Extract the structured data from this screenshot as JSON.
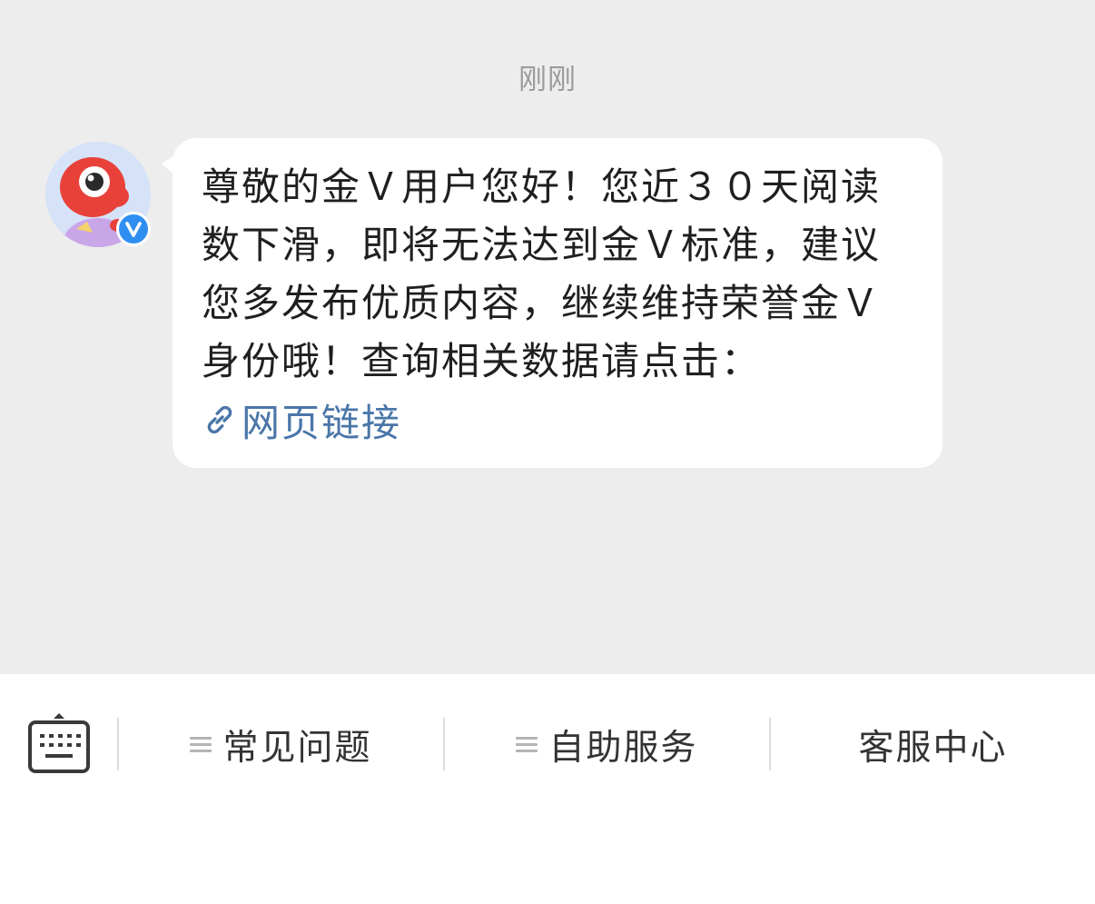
{
  "chat": {
    "timestamp": "刚刚",
    "message": {
      "text": "尊敬的金Ｖ用户您好！您近３０天阅读数下滑，即将无法达到金Ｖ标准，建议您多发布优质内容，继续维持荣誉金Ｖ身份哦！查询相关数据请点击：",
      "link_label": "网页链接",
      "link_icon": "link-icon"
    },
    "avatar": {
      "badge": "V",
      "badge_color": "#2f8ff0"
    }
  },
  "bottom_menu": {
    "keyboard_icon": "keyboard-icon",
    "items": [
      {
        "label": "常见问题",
        "has_menu_icon": true
      },
      {
        "label": "自助服务",
        "has_menu_icon": true
      },
      {
        "label": "客服中心",
        "has_menu_icon": false
      }
    ]
  },
  "colors": {
    "chat_background": "#ededed",
    "link": "#4a76a8",
    "text": "#1f1f1f"
  }
}
